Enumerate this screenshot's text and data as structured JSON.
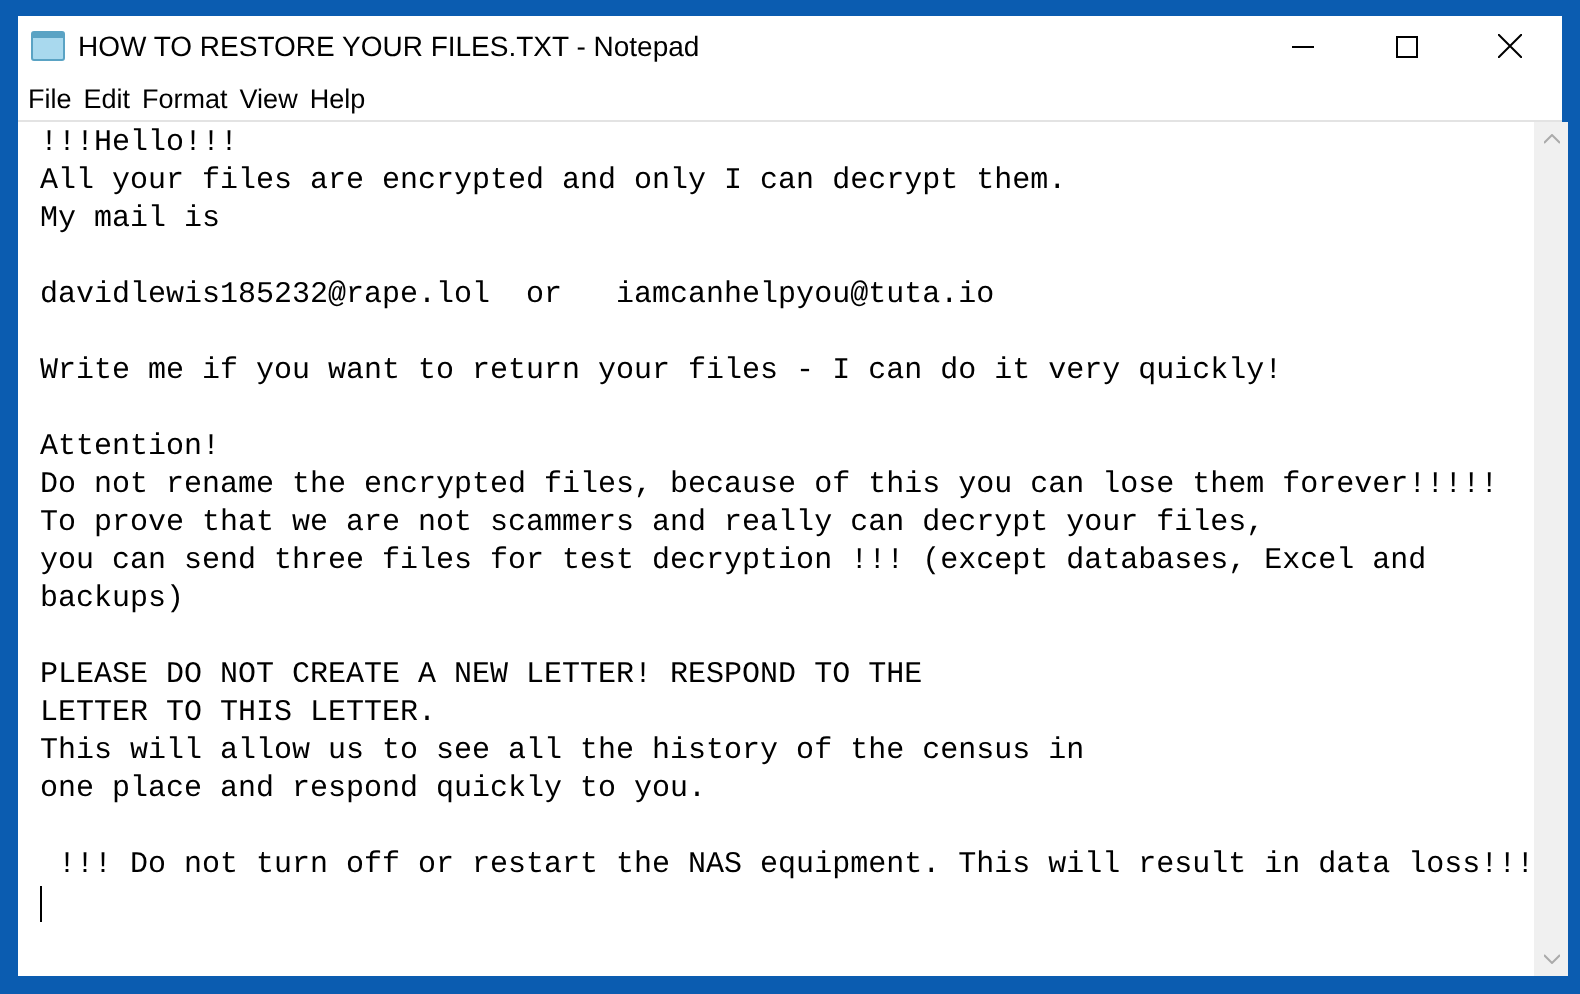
{
  "window": {
    "title": "HOW TO RESTORE YOUR FILES.TXT - Notepad"
  },
  "menu": [
    "File",
    "Edit",
    "Format",
    "View",
    "Help"
  ],
  "document": {
    "paragraphs": [
      [
        "!!!Hello!!!",
        "All your files are encrypted and only I can decrypt them.",
        "My mail is"
      ],
      [
        "davidlewis185232@rape.lol  or   iamcanhelpyou@tuta.io"
      ],
      [
        "Write me if you want to return your files - I can do it very quickly!"
      ],
      [
        "Attention!",
        "Do not rename the encrypted files, because of this you can lose them forever!!!!!",
        "To prove that we are not scammers and really can decrypt your files,",
        "you can send three files for test decryption !!! (except databases, Excel and",
        "backups)"
      ],
      [
        "PLEASE DO NOT CREATE A NEW LETTER! RESPOND TO THE",
        "LETTER TO THIS LETTER.",
        "This will allow us to see all the history of the census in",
        "one place and respond quickly to you."
      ],
      [
        " !!! Do not turn off or restart the NAS equipment. This will result in data loss!!!"
      ]
    ]
  }
}
